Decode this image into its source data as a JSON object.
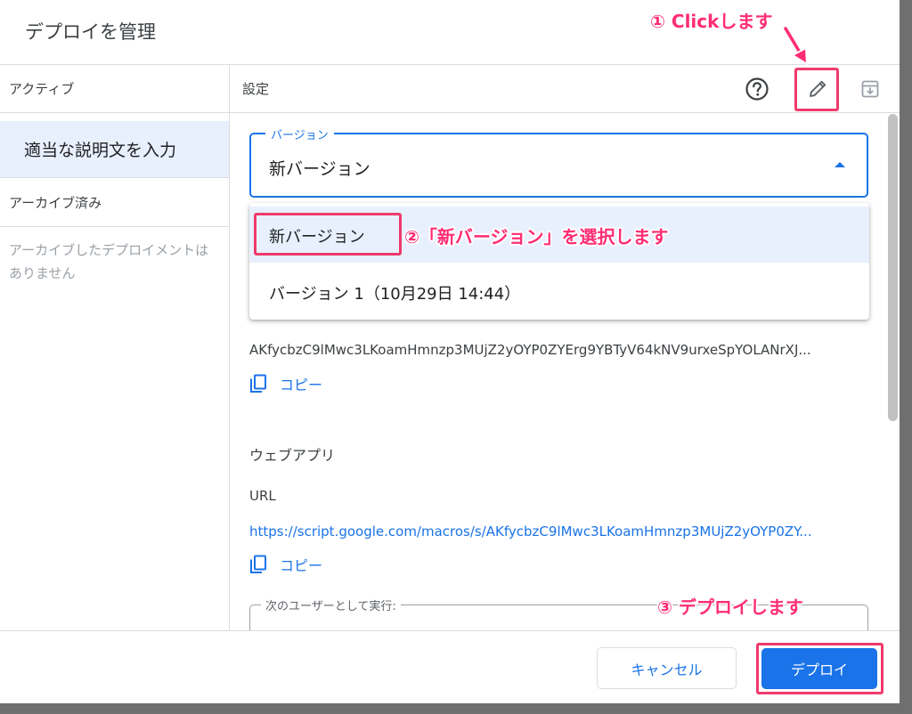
{
  "dialog": {
    "title": "デプロイを管理"
  },
  "sidebar": {
    "active_heading": "アクティブ",
    "active_item": "適当な説明文を入力",
    "archived_heading": "アーカイブ済み",
    "archived_empty": "アーカイブしたデプロイメントはありません"
  },
  "settings": {
    "label": "設定",
    "help_icon": "help-circle-icon",
    "edit_icon": "pencil-icon",
    "archive_icon": "archive-icon"
  },
  "version_select": {
    "legend": "バージョン",
    "value": "新バージョン",
    "options": [
      {
        "label": "新バージョン"
      },
      {
        "label": "バージョン 1（10月29日 14:44）"
      }
    ]
  },
  "deployment": {
    "id": "AKfycbzC9lMwc3LKoamHmnzp3MUjZ2yOYP0ZYErg9YBTyV64kNV9urxeSpYOLANrXJ...",
    "copy_label": "コピー"
  },
  "webapp": {
    "section_title": "ウェブアプリ",
    "url_label": "URL",
    "url": "https://script.google.com/macros/s/AKfycbzC9lMwc3LKoamHmnzp3MUjZ2yOYP0ZY...",
    "copy_label": "コピー"
  },
  "execute_as": {
    "legend": "次のユーザーとして実行:"
  },
  "footer": {
    "cancel_label": "キャンセル",
    "deploy_label": "デプロイ"
  },
  "annotations": {
    "step1": "① Clickします",
    "step2": "②「新バージョン」を選択します",
    "step3": "③ デプロイします"
  },
  "colors": {
    "accent": "#1a73e8",
    "highlight": "#ef3a6b",
    "annotation": "#ff2d74",
    "selected_bg": "#e8f0fe"
  }
}
